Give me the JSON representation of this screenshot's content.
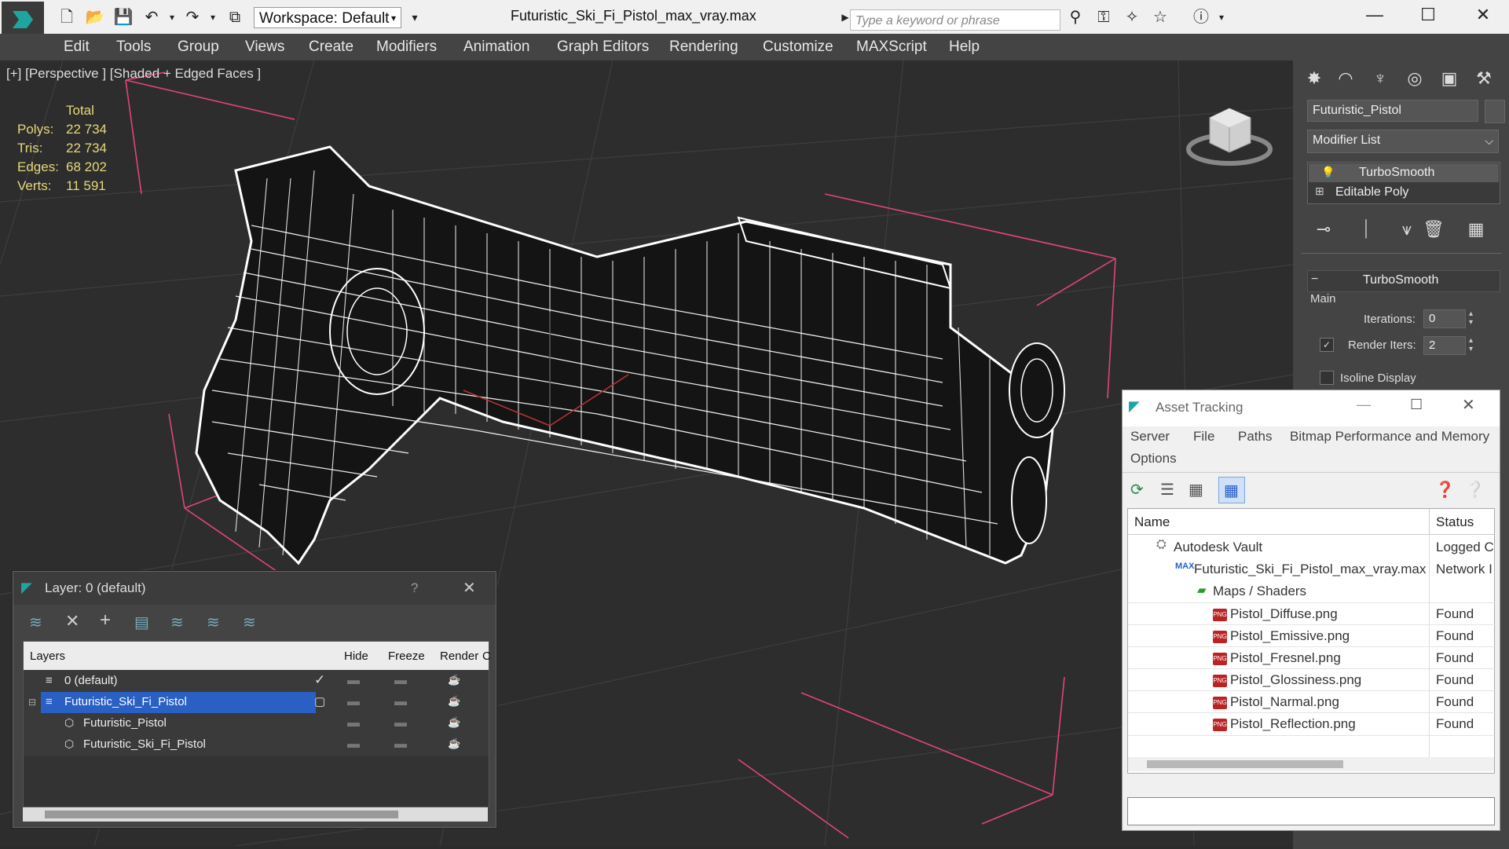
{
  "app": {
    "title": "Futuristic_Ski_Fi_Pistol_max_vray.max",
    "workspace": "Workspace: Default",
    "search_placeholder": "Type a keyword or phrase"
  },
  "menubar": {
    "items": [
      "Edit",
      "Tools",
      "Group",
      "Views",
      "Create",
      "Modifiers",
      "Animation",
      "Graph Editors",
      "Rendering",
      "Customize",
      "MAXScript",
      "Help"
    ]
  },
  "viewport": {
    "label": "[+] [Perspective ] [Shaded + Edged Faces ]",
    "stats": {
      "header": "Total",
      "rows": [
        {
          "label": "Polys:",
          "value": "22 734"
        },
        {
          "label": "Tris:",
          "value": "22 734"
        },
        {
          "label": "Edges:",
          "value": "68 202"
        },
        {
          "label": "Verts:",
          "value": "11 591"
        }
      ]
    }
  },
  "command_panel": {
    "object_name": "Futuristic_Pistol",
    "modifier_list": "Modifier List",
    "stack": [
      "TurboSmooth",
      "Editable Poly"
    ],
    "rollout_title": "TurboSmooth",
    "group_main": "Main",
    "iterations_label": "Iterations:",
    "iterations_value": "0",
    "render_iters_label": "Render Iters:",
    "render_iters_value": "2",
    "isoline_label": "Isoline Display"
  },
  "layer_dialog": {
    "title": "Layer: 0 (default)",
    "help": "?",
    "columns": [
      "Layers",
      "Hide",
      "Freeze",
      "Render",
      "C"
    ],
    "rows": [
      {
        "name": "0 (default)",
        "level": 1,
        "selected": false
      },
      {
        "name": "Futuristic_Ski_Fi_Pistol",
        "level": 1,
        "selected": true
      },
      {
        "name": "Futuristic_Pistol",
        "level": 2,
        "selected": false
      },
      {
        "name": "Futuristic_Ski_Fi_Pistol",
        "level": 2,
        "selected": false
      }
    ]
  },
  "asset_dialog": {
    "title": "Asset Tracking",
    "menu": [
      "Server",
      "File",
      "Paths",
      "Bitmap Performance and Memory",
      "Options"
    ],
    "columns": [
      "Name",
      "Status"
    ],
    "rows": [
      {
        "name": "Autodesk Vault",
        "status": "Logged C",
        "indent": 1,
        "icon": "vault"
      },
      {
        "name": "Futuristic_Ski_Fi_Pistol_max_vray.max",
        "status": "Network I",
        "indent": 2,
        "icon": "max"
      },
      {
        "name": "Maps / Shaders",
        "status": "",
        "indent": 3,
        "icon": "maps"
      },
      {
        "name": "Pistol_Diffuse.png",
        "status": "Found",
        "indent": 4,
        "icon": "png"
      },
      {
        "name": "Pistol_Emissive.png",
        "status": "Found",
        "indent": 4,
        "icon": "png"
      },
      {
        "name": "Pistol_Fresnel.png",
        "status": "Found",
        "indent": 4,
        "icon": "png"
      },
      {
        "name": "Pistol_Glossiness.png",
        "status": "Found",
        "indent": 4,
        "icon": "png"
      },
      {
        "name": "Pistol_Narmal.png",
        "status": "Found",
        "indent": 4,
        "icon": "png"
      },
      {
        "name": "Pistol_Reflection.png",
        "status": "Found",
        "indent": 4,
        "icon": "png"
      }
    ]
  },
  "colors": {
    "accent_blue": "#2a5fc4",
    "stat_yellow": "#e5d87a",
    "bbox_pink": "#e0457a"
  }
}
